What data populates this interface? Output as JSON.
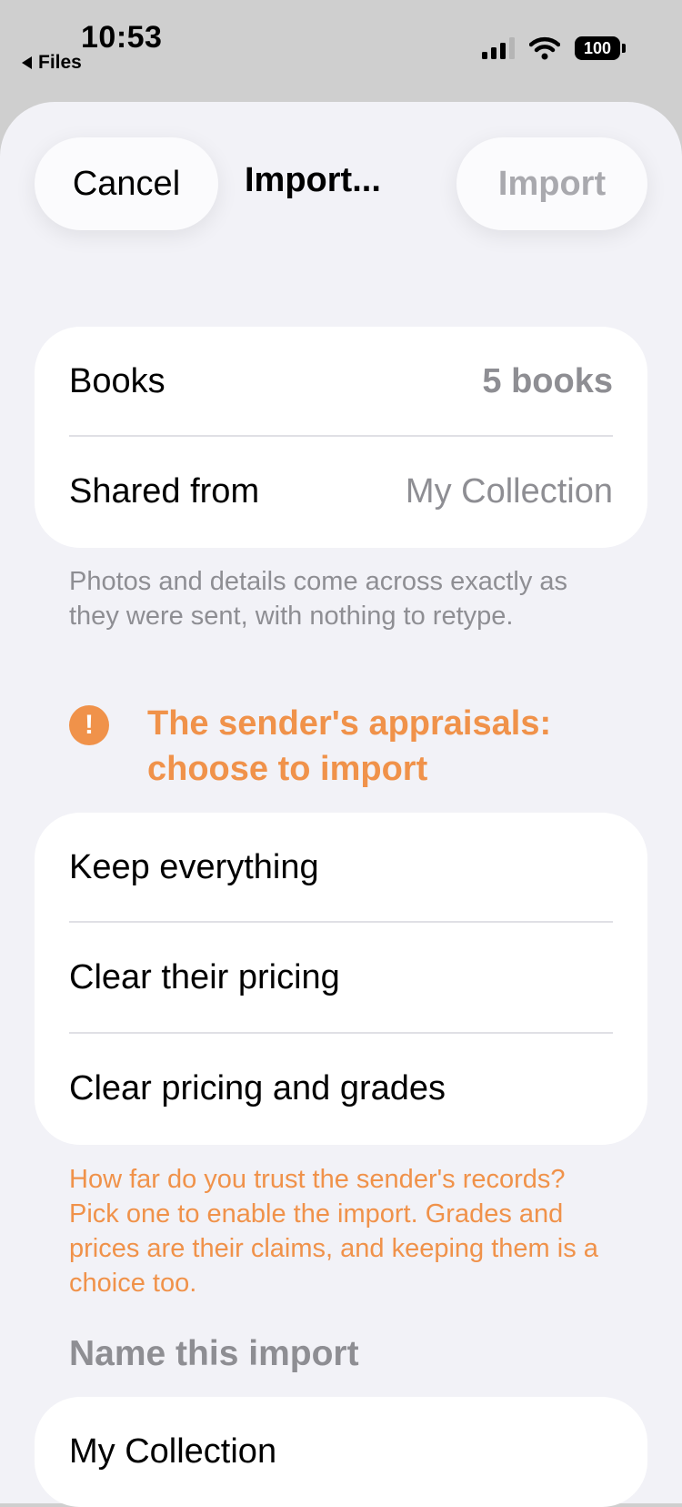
{
  "status_bar": {
    "time": "10:53",
    "back_label": "Files",
    "battery": "100"
  },
  "nav": {
    "cancel_label": "Cancel",
    "title": "Import...",
    "import_label": "Import"
  },
  "summary": {
    "books_label": "Books",
    "books_value": "5 books",
    "shared_label": "Shared from",
    "shared_value": "My Collection",
    "footnote": "Photos and details come across exactly as they were sent, with nothing to retype."
  },
  "appraisals": {
    "warning_icon": "exclamation-circle-icon",
    "title": "The sender's appraisals: choose to import",
    "options": [
      "Keep everything",
      "Clear their pricing",
      "Clear pricing and grades"
    ],
    "note": "How far do you trust the sender's records? Pick one to enable the import. Grades and prices are their claims, and keeping them is a choice too."
  },
  "name_section": {
    "header": "Name this import",
    "value": "My Collection"
  },
  "colors": {
    "accent": "#f0924a",
    "secondary_text": "#8e8e93",
    "background": "#f2f2f7"
  }
}
